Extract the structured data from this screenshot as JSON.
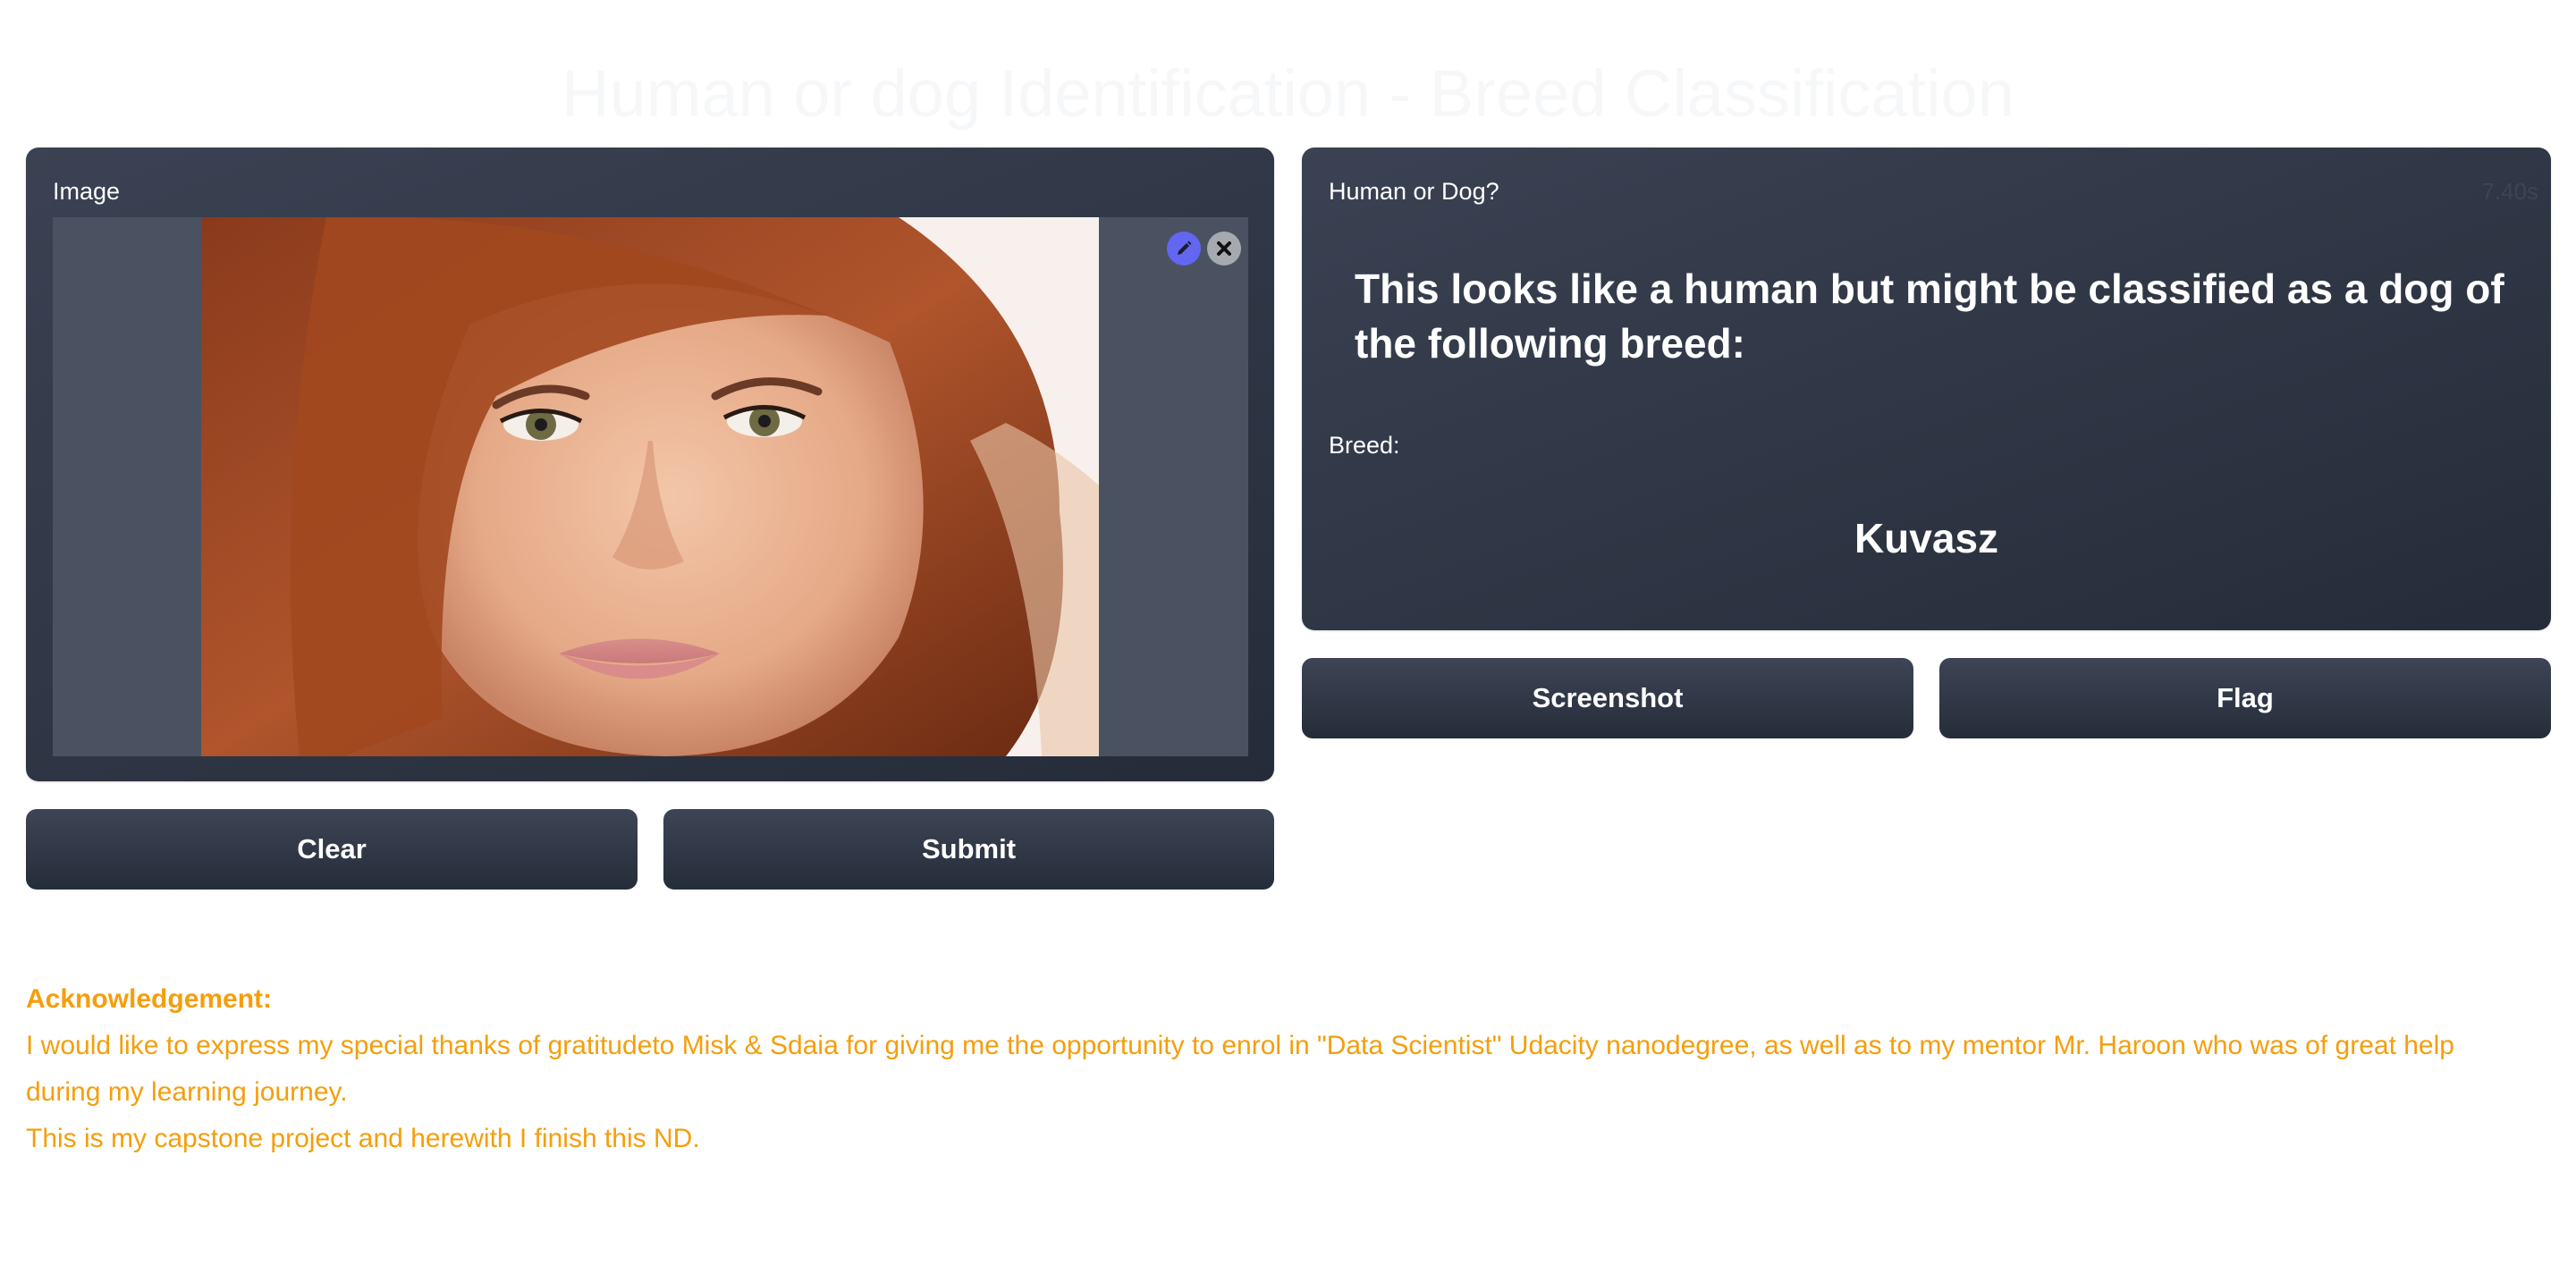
{
  "header": {
    "title": "Human or dog Identification - Breed Classification"
  },
  "input_panel": {
    "label": "Image"
  },
  "output_panel": {
    "label": "Human or Dog?",
    "timer": "7.40s",
    "message": "This looks like a human but might be classified as a dog of the following breed:",
    "breed_label": "Breed:",
    "breed_value": "Kuvasz"
  },
  "actions": {
    "clear": "Clear",
    "submit": "Submit",
    "screenshot": "Screenshot",
    "flag": "Flag"
  },
  "acknowledgement": {
    "title": "Acknowledgement:",
    "body": "I would like to express my special thanks of gratitudeto Misk & Sdaia for giving me the opportunity to enrol in \"Data Scientist\" Udacity nanodegree, as well as to my mentor Mr. Haroon who was of great help during my learning journey.",
    "closing": "This is my capstone project and herewith I finish this ND."
  },
  "icons": {
    "edit": "pencil-icon",
    "remove": "close-icon"
  },
  "colors": {
    "accent": "#f59e0b",
    "panel": "#2b3240",
    "edit_button": "#6366f1"
  }
}
